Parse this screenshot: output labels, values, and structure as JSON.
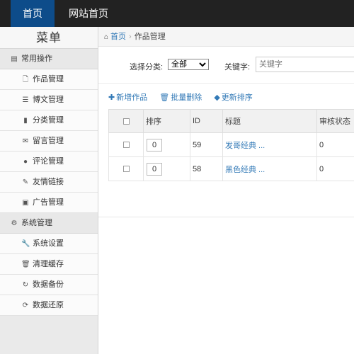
{
  "topnav": {
    "home": "首页",
    "site": "网站首页"
  },
  "sidebar": {
    "title": "菜单",
    "groups": [
      {
        "label": "常用操作",
        "icon": "list-icon",
        "items": [
          {
            "label": "作品管理",
            "icon": "file-icon"
          },
          {
            "label": "博文管理",
            "icon": "article-icon"
          },
          {
            "label": "分类管理",
            "icon": "category-icon"
          },
          {
            "label": "留言管理",
            "icon": "mail-icon"
          },
          {
            "label": "评论管理",
            "icon": "comment-icon"
          },
          {
            "label": "友情链接",
            "icon": "link-icon"
          },
          {
            "label": "广告管理",
            "icon": "image-icon"
          }
        ]
      },
      {
        "label": "系统管理",
        "icon": "gear-icon",
        "items": [
          {
            "label": "系统设置",
            "icon": "wrench-icon"
          },
          {
            "label": "清理缓存",
            "icon": "trash-icon"
          },
          {
            "label": "数据备份",
            "icon": "backup-icon"
          },
          {
            "label": "数据还原",
            "icon": "restore-icon"
          }
        ]
      }
    ]
  },
  "breadcrumb": {
    "home": "首页",
    "current": "作品管理"
  },
  "filter": {
    "category_label": "选择分类:",
    "category_value": "全部",
    "keyword_label": "关键字:",
    "keyword_placeholder": "关键字"
  },
  "actions": {
    "add": "新增作品",
    "batch_delete": "批量删除",
    "update_sort": "更新排序"
  },
  "table": {
    "headers": {
      "sort": "排序",
      "id": "ID",
      "title": "标题",
      "status": "审核状态"
    },
    "rows": [
      {
        "sort": "0",
        "id": "59",
        "title": "发哥经典 ...",
        "status": "0"
      },
      {
        "sort": "0",
        "id": "58",
        "title": "黑色经典 ...",
        "status": "0"
      }
    ]
  },
  "colors": {
    "topbar": "#222222",
    "active_nav": "#0d4c8a",
    "link": "#337ab7",
    "sidebar": "#eaeaea"
  }
}
